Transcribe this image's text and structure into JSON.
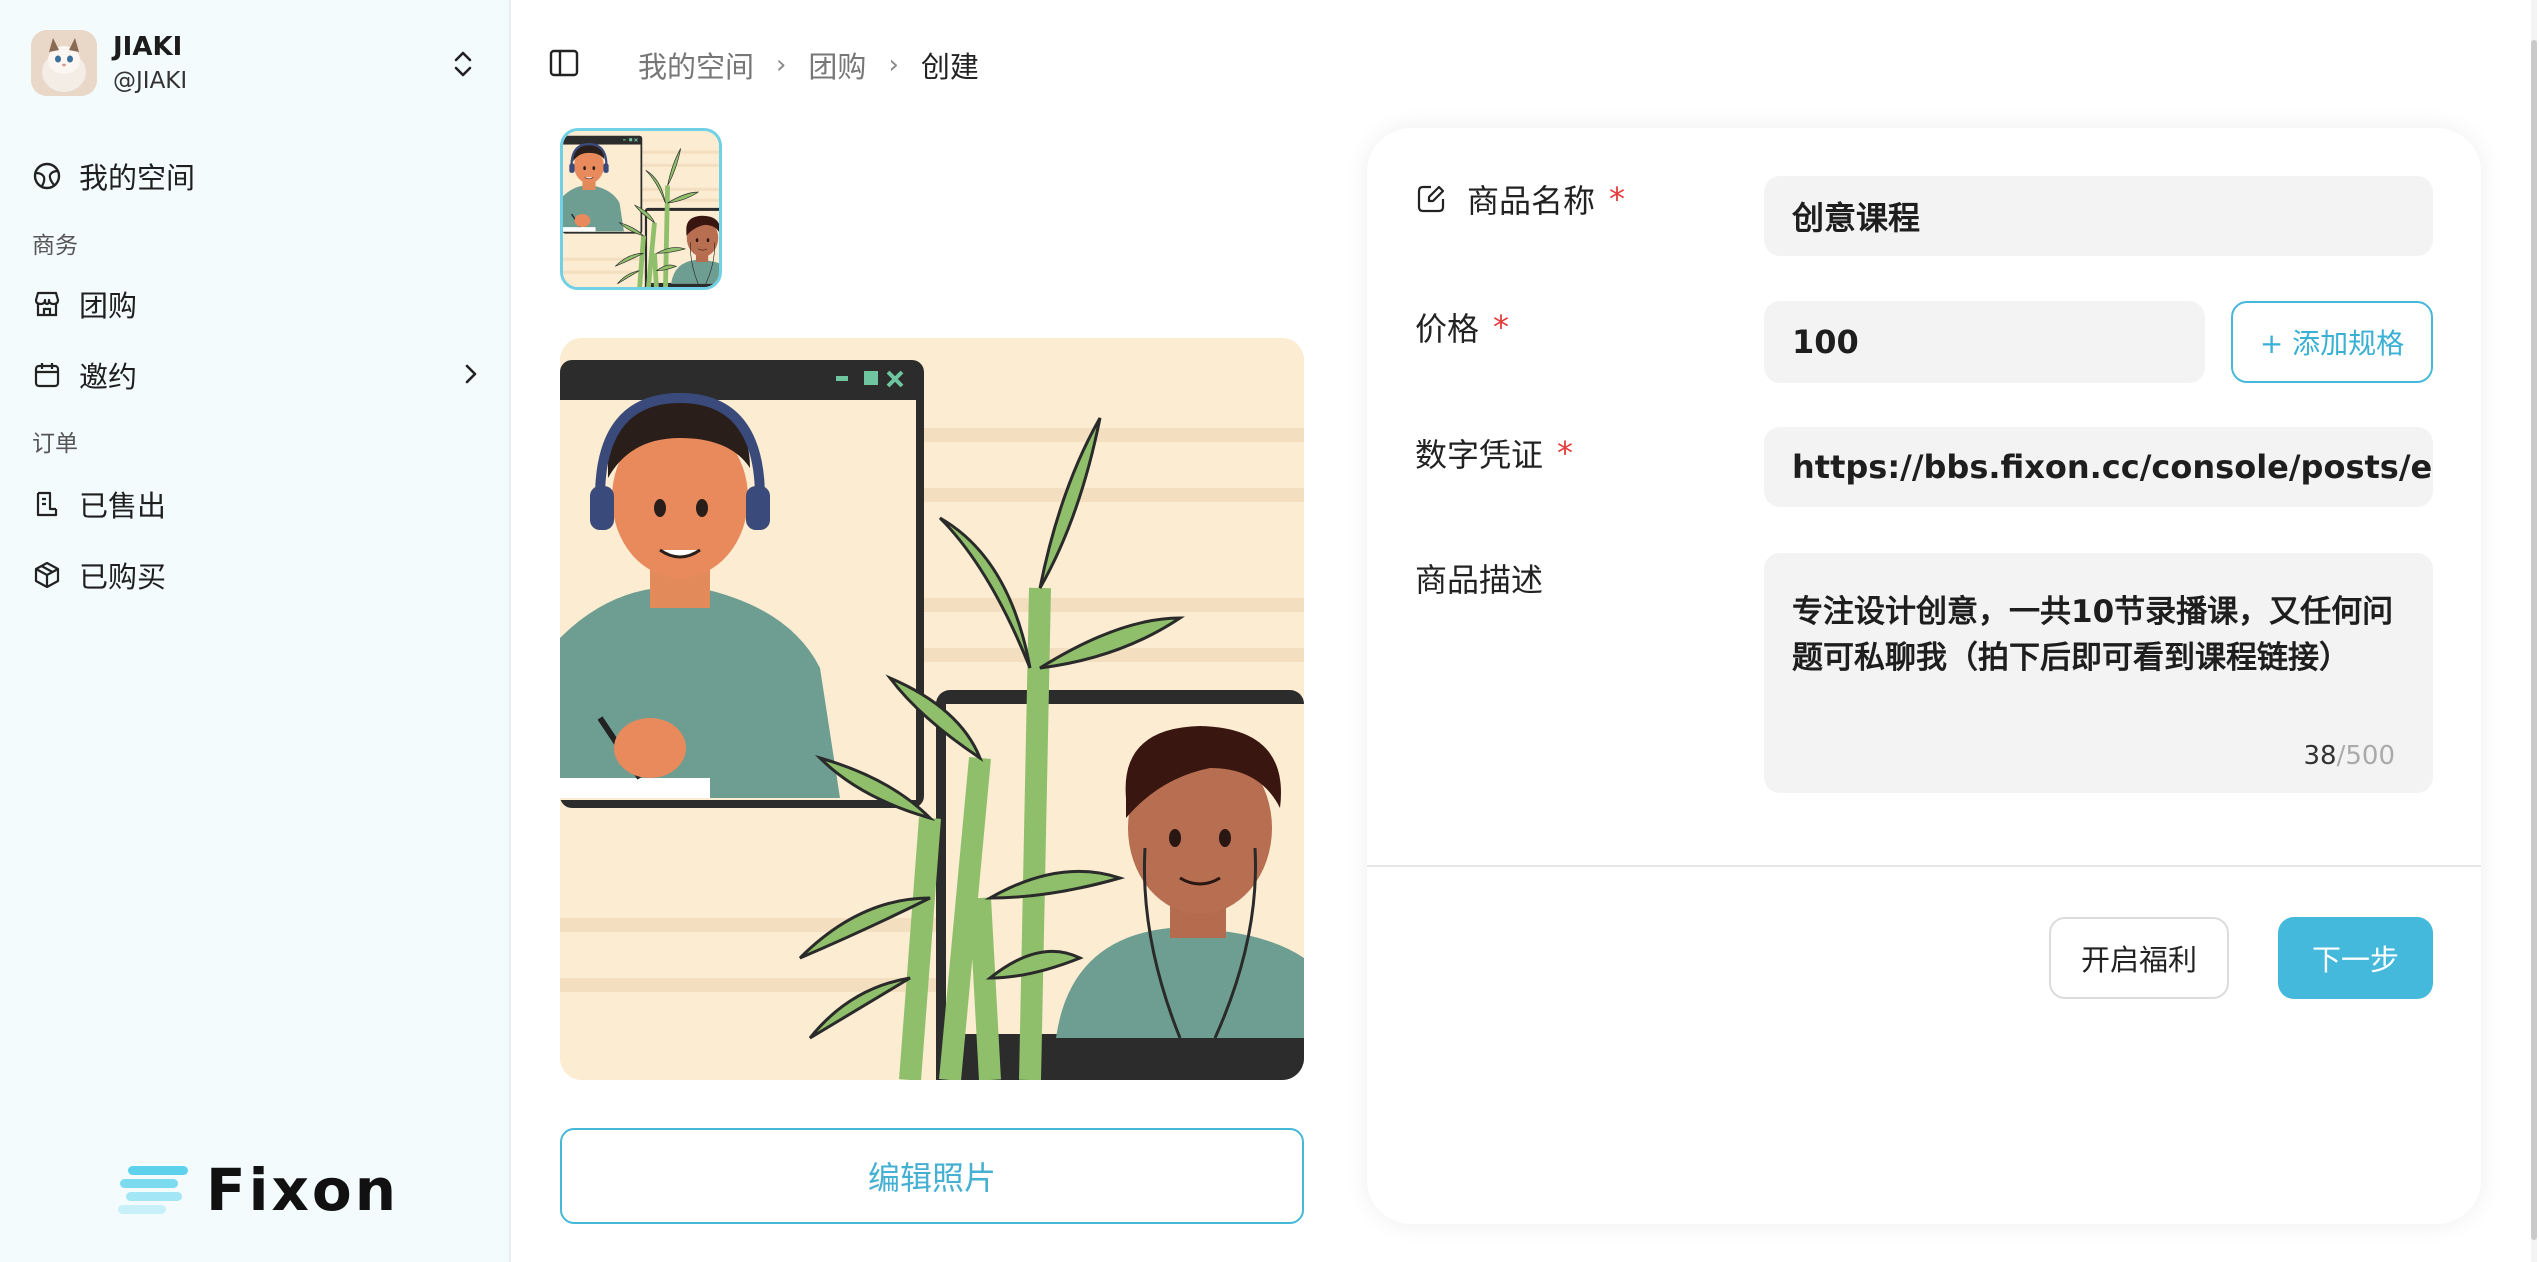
{
  "sidebar": {
    "user": {
      "name": "JIAKI",
      "handle": "@JIAKI"
    },
    "my_space": "我的空间",
    "section_business": "商务",
    "group_buy": "团购",
    "invite": "邀约",
    "section_orders": "订单",
    "sold": "已售出",
    "purchased": "已购买",
    "brand": "Fixon"
  },
  "breadcrumb": {
    "items": [
      "我的空间",
      "团购",
      "创建"
    ]
  },
  "media": {
    "edit_photo_label": "编辑照片"
  },
  "form": {
    "name_label": "商品名称",
    "name_value": "创意课程",
    "price_label": "价格",
    "price_value": "100",
    "add_spec_label": "+ 添加规格",
    "voucher_label": "数字凭证",
    "voucher_value": "https://bbs.fixon.cc/console/posts/editor?r",
    "required_mark": "*",
    "desc_label": "商品描述",
    "desc_value": "专注设计创意，一共10节录播课，又任何问题可私聊我（拍下后即可看到课程链接）",
    "desc_count": "38",
    "desc_max": "/500",
    "welfare_button": "开启福利",
    "next_button": "下一步"
  },
  "colors": {
    "accent": "#44b9dc",
    "required": "#e53b3b",
    "sidebar_bg": "#f3fbfc"
  }
}
